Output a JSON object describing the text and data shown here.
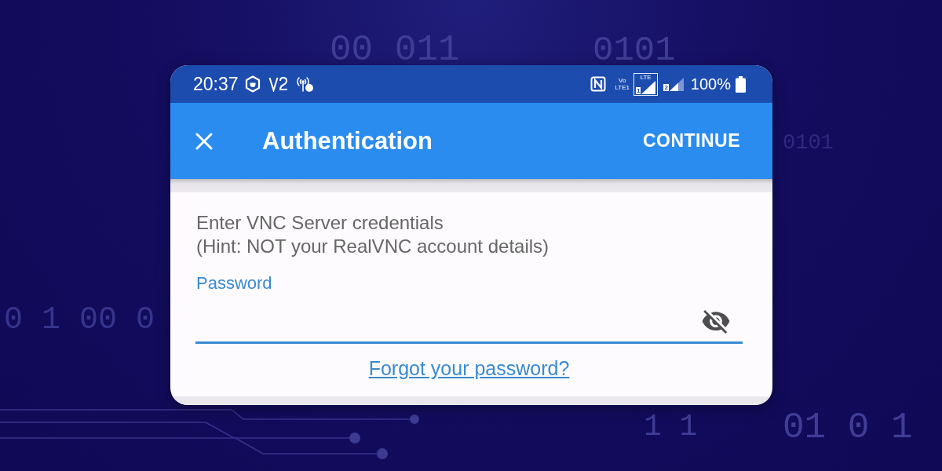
{
  "background": {
    "digits": [
      "00 011",
      "0101",
      "0101",
      "0 1 00 0",
      "1 1",
      "01 0 1"
    ]
  },
  "status_bar": {
    "time": "20:37",
    "volte": [
      "Vo",
      "LTE1"
    ],
    "signals": [
      {
        "sim": "1",
        "network": "LTE",
        "active": true
      },
      {
        "sim": "2",
        "active": false
      }
    ],
    "battery": "100%"
  },
  "app_bar": {
    "title": "Authentication",
    "action": "CONTINUE"
  },
  "form": {
    "intro": [
      "Enter VNC Server credentials",
      "(Hint: NOT your RealVNC account details)"
    ],
    "password": {
      "label": "Password",
      "visible": false
    },
    "link": "Forgot your password?"
  }
}
